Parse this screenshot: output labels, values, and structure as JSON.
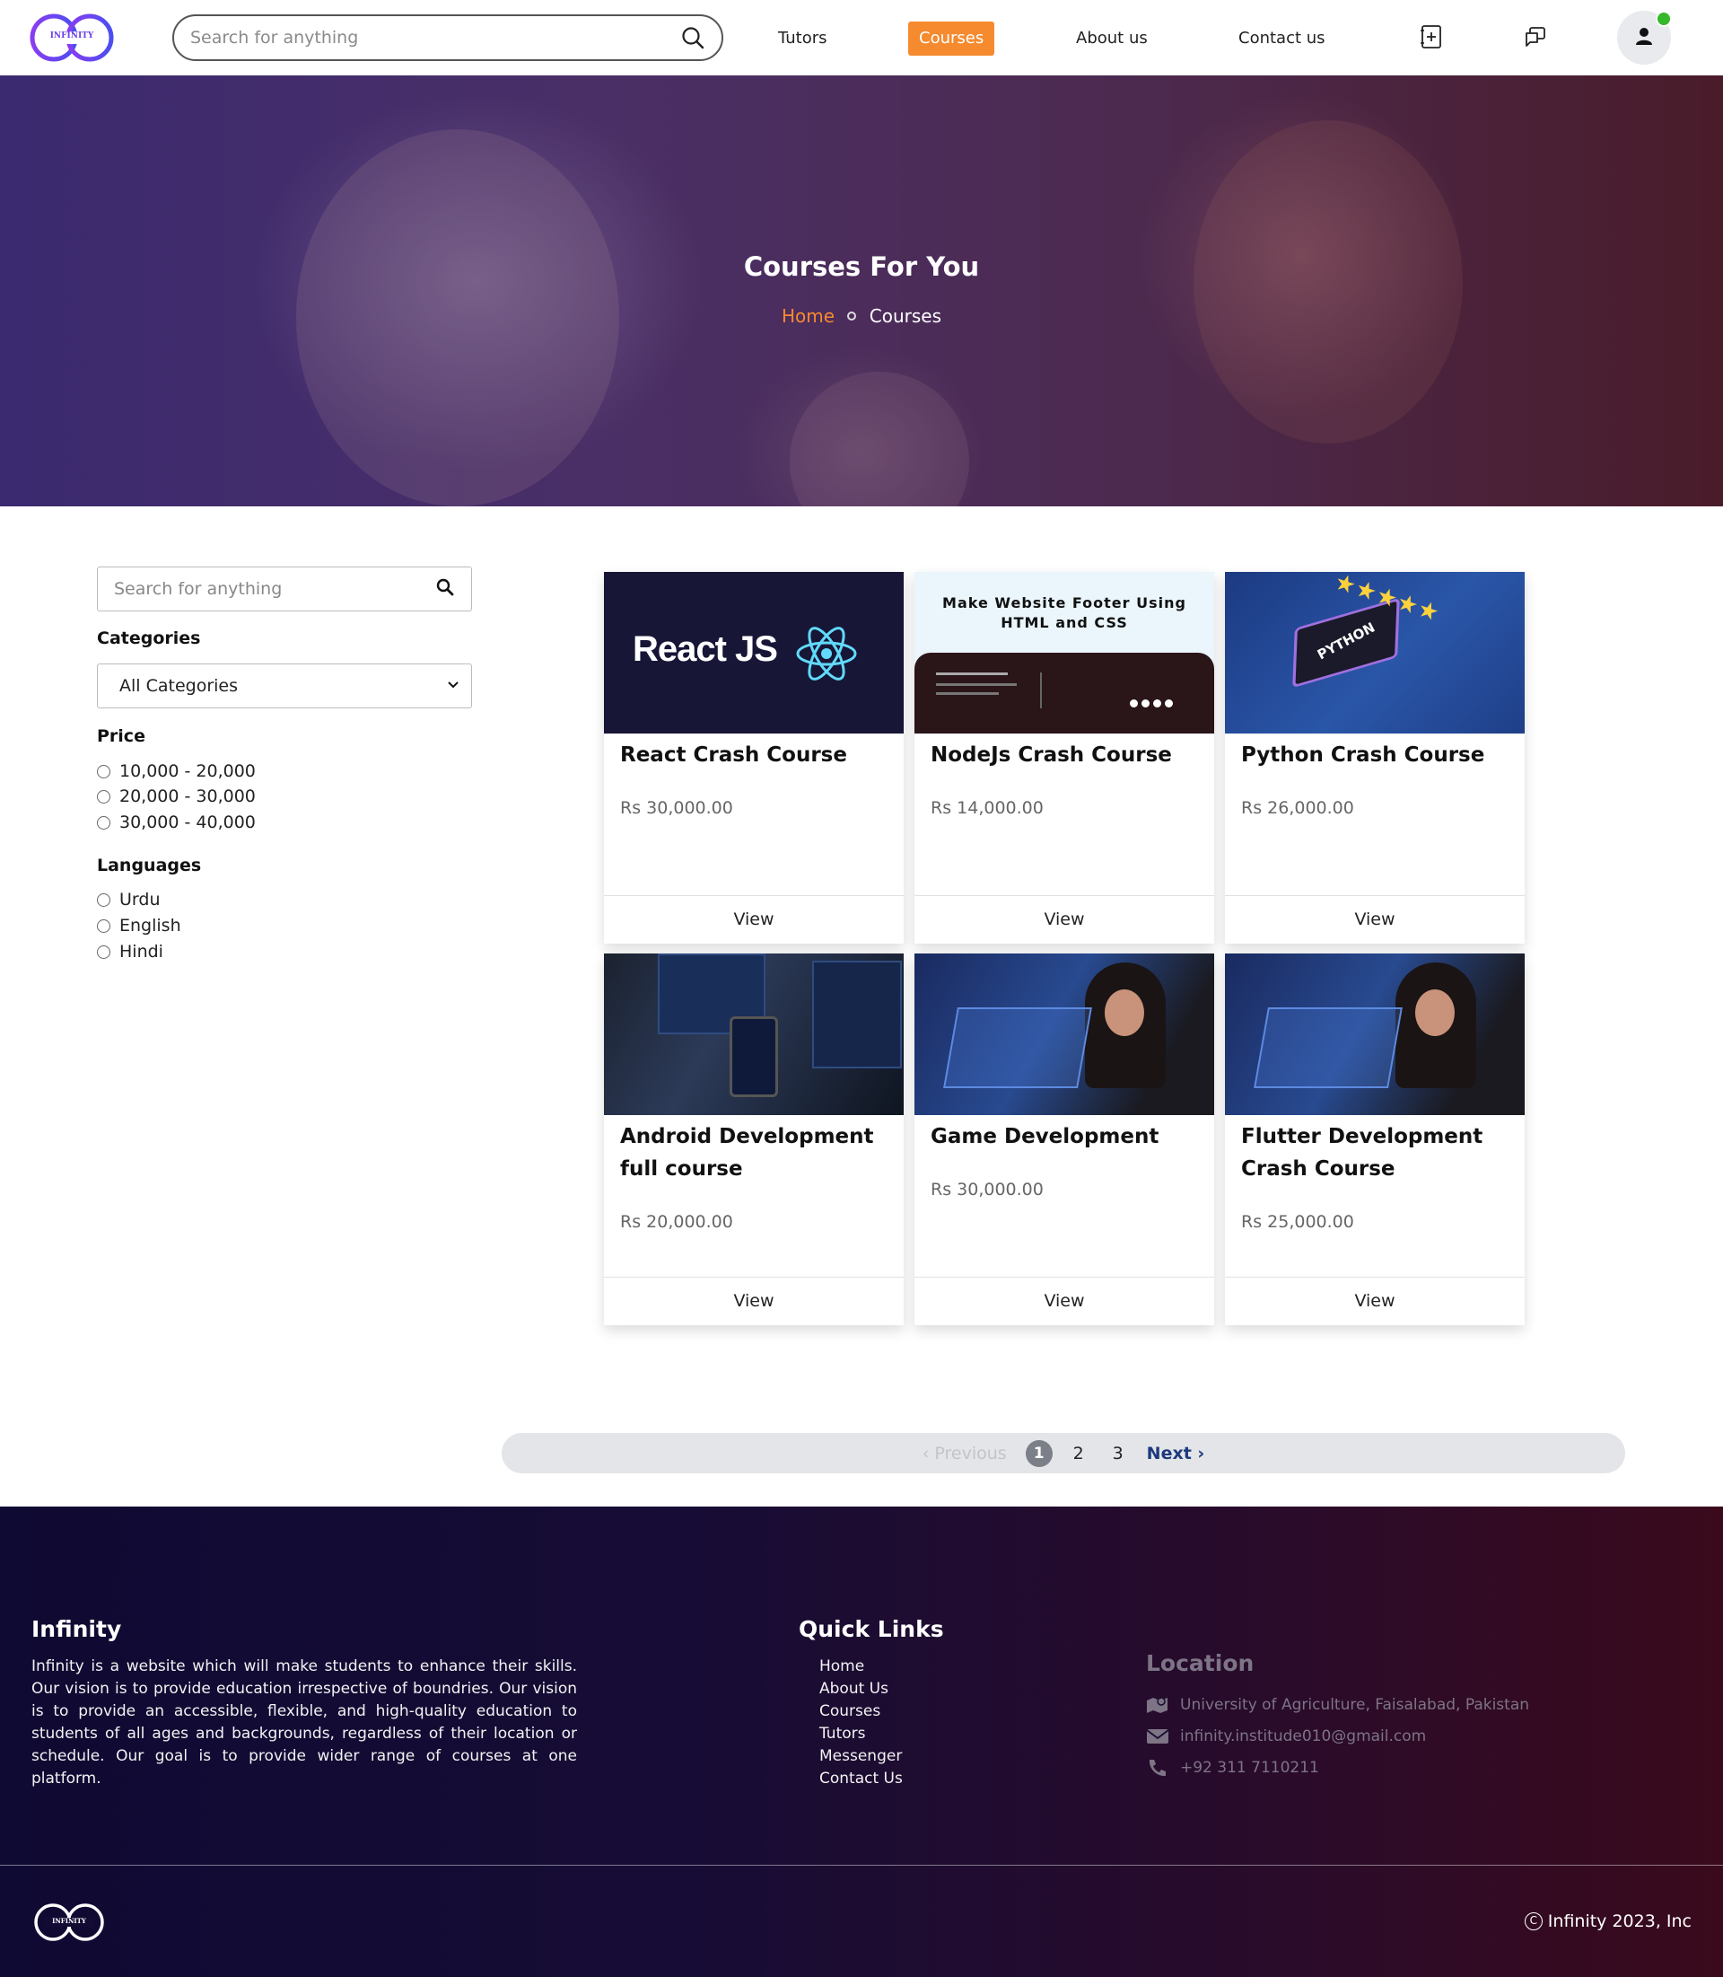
{
  "brand": {
    "logo_text": "INFINITY",
    "accent": "#f58a2e",
    "logo_color": "#6a3ee8"
  },
  "nav": {
    "search_placeholder": "Search for anything",
    "links": [
      {
        "label": "Tutors"
      },
      {
        "label": "Courses",
        "active": true
      },
      {
        "label": "About us"
      },
      {
        "label": "Contact us"
      }
    ],
    "icons": [
      "add-note-icon",
      "chat-icon",
      "user-icon"
    ],
    "online_status_color": "#35b82a"
  },
  "hero": {
    "title": "Courses For You",
    "breadcrumb": {
      "home": "Home",
      "current": "Courses"
    }
  },
  "sidebar": {
    "search_placeholder": "Search for anything",
    "categories_heading": "Categories",
    "categories_selected": "All Categories",
    "price_heading": "Price",
    "price_options": [
      "10,000 - 20,000",
      "20,000 - 30,000",
      "30,000 - 40,000"
    ],
    "languages_heading": "Languages",
    "language_options": [
      "Urdu",
      "English",
      "Hindi"
    ]
  },
  "courses": [
    {
      "title": "React Crash Course",
      "price": "Rs 30,000.00",
      "button": "View",
      "thumb_text": "React JS"
    },
    {
      "title": "NodeJs Crash Course",
      "price": "Rs 14,000.00",
      "button": "View",
      "thumb_text": "Make Website Footer Using HTML and CSS"
    },
    {
      "title": "Python Crash Course",
      "price": "Rs 26,000.00",
      "button": "View",
      "thumb_text": "PYTHON"
    },
    {
      "title": "Android Development full course",
      "price": "Rs 20,000.00",
      "button": "View"
    },
    {
      "title": "Game Development",
      "price": "Rs 30,000.00",
      "button": "View"
    },
    {
      "title": "Flutter Development Crash Course",
      "price": "Rs 25,000.00",
      "button": "View"
    }
  ],
  "pagination": {
    "prev": "‹ Previous",
    "pages": [
      "1",
      "2",
      "3"
    ],
    "current": "1",
    "next": "Next ›"
  },
  "footer": {
    "brand_heading": "Infinity",
    "about": "Infinity is a website which will make students to enhance their skills. Our vision is to provide education irrespective of boundries. Our vision is to provide an accessible, flexible, and high-quality education to students of all ages and backgrounds, regardless of their location or schedule. Our goal is to provide wider range of courses at one platform.",
    "quick_links_heading": "Quick Links",
    "quick_links": [
      "Home",
      "About Us",
      "Courses",
      "Tutors",
      "Messenger",
      "Contact Us"
    ],
    "location_heading": "Location",
    "address": "University of Agriculture, Faisalabad, Pakistan",
    "email": "infinity.institude010@gmail.com",
    "phone": "+92 311 7110211",
    "copyright": "Infinity 2023, Inc"
  }
}
